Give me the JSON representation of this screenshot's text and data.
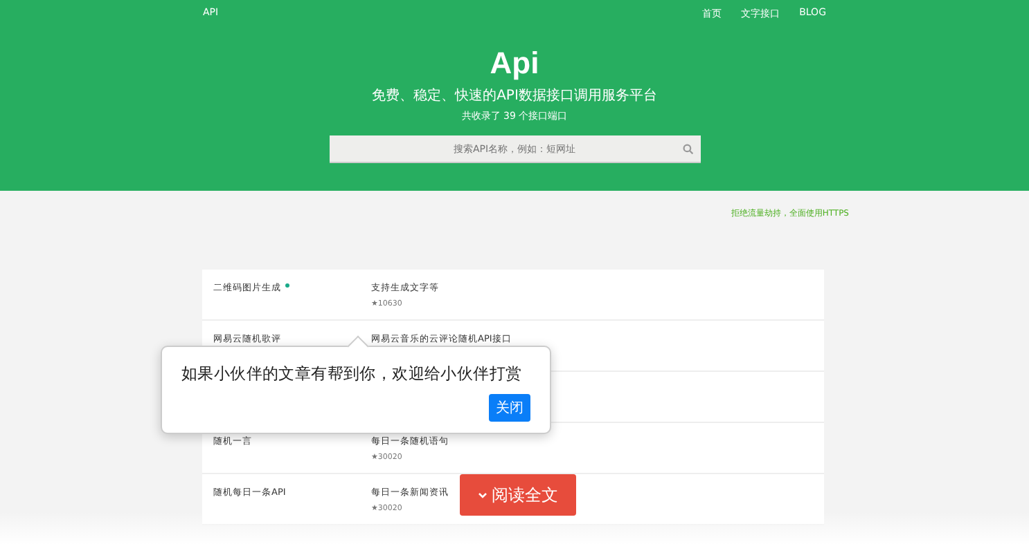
{
  "header": {
    "logo": "API",
    "nav": [
      {
        "label": "首页"
      },
      {
        "label": "文字接口"
      },
      {
        "label": "BLOG"
      }
    ],
    "title": "Api",
    "subtitle": "免费、稳定、快速的API数据接口调用服务平台",
    "count": "共收录了 39 个接口端口",
    "search": {
      "placeholder": "搜索API名称，例如：短网址"
    }
  },
  "notice": "拒绝流量劫持，全面使用HTTPS",
  "apis": [
    {
      "name": "二维码图片生成",
      "new": true,
      "desc": "支持生成文字等",
      "stars": "★10630"
    },
    {
      "name": "网易云随机歌评",
      "new": false,
      "desc": "网易云音乐的云评论随机API接口"
    },
    {
      "name": "随机一言",
      "new": false,
      "desc": "每日一条随机语句",
      "stars": "★30020"
    },
    {
      "name": "随机每日一条API",
      "new": false,
      "desc": "每日一条新闻资讯",
      "stars": "★30020"
    }
  ],
  "popup": {
    "message": "如果小伙伴的文章有帮到你，欢迎给小伙伴打赏",
    "button": "关闭"
  },
  "read_more": "阅读全文"
}
